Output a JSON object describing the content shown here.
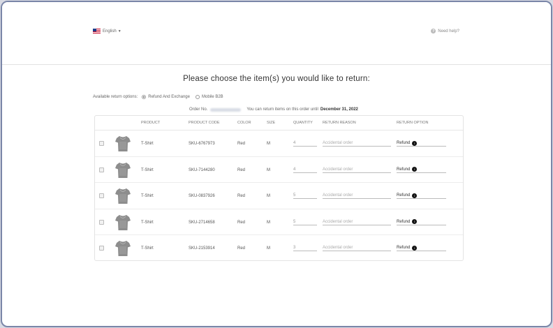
{
  "header": {
    "language_label": "English",
    "language_icon": "us-flag-icon",
    "help_label": "Need help?"
  },
  "title": "Please choose the item(s) you would like to return:",
  "return_options": {
    "label": "Available return options:",
    "options": [
      "Refund And Exchange",
      "Mobile B2B"
    ],
    "selected": "Refund And Exchange"
  },
  "order": {
    "label": "Order No.",
    "note": "You can return items on this order until",
    "deadline": "December 31, 2022"
  },
  "columns": {
    "product": "PRODUCT",
    "code": "PRODUCT CODE",
    "color": "COLOR",
    "size": "SIZE",
    "quantity": "QUANTITY",
    "reason": "RETURN REASON",
    "option": "RETURN OPTION"
  },
  "rows": [
    {
      "product": "T-Shirt",
      "code": "SKU-6767973",
      "color": "Red",
      "size": "M",
      "quantity": "4",
      "reason_placeholder": "Accidental order",
      "option": "Refund"
    },
    {
      "product": "T-Shirt",
      "code": "SKU-7144280",
      "color": "Red",
      "size": "M",
      "quantity": "4",
      "reason_placeholder": "Accidental order",
      "option": "Refund"
    },
    {
      "product": "T-Shirt",
      "code": "SKU-0837926",
      "color": "Red",
      "size": "M",
      "quantity": "5",
      "reason_placeholder": "Accidental order",
      "option": "Refund"
    },
    {
      "product": "T-Shirt",
      "code": "SKU-2714658",
      "color": "Red",
      "size": "M",
      "quantity": "5",
      "reason_placeholder": "Accidental order",
      "option": "Refund"
    },
    {
      "product": "T-Shirt",
      "code": "SKU-2153914",
      "color": "Red",
      "size": "M",
      "quantity": "3",
      "reason_placeholder": "Accidental order",
      "option": "Refund"
    }
  ],
  "colors": {
    "frame_border": "#7a86a8",
    "row_border": "#ececec",
    "info_icon": "#111111"
  }
}
